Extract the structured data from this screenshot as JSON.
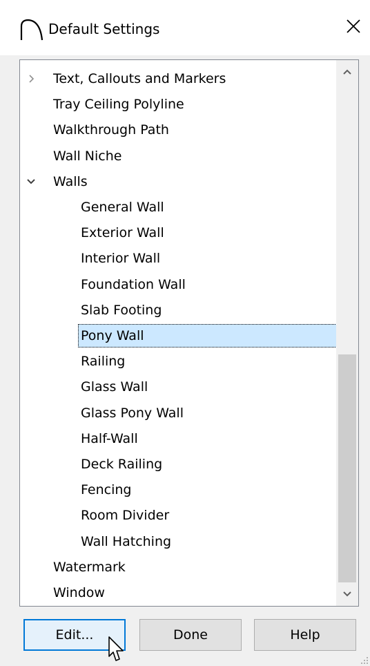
{
  "window": {
    "title": "Default Settings",
    "close_glyph": "✕"
  },
  "tree": {
    "items": [
      {
        "label": "Text, Callouts and Markers",
        "level": 0,
        "twisty": "collapsed"
      },
      {
        "label": "Tray Ceiling Polyline",
        "level": 0,
        "twisty": "none"
      },
      {
        "label": "Walkthrough Path",
        "level": 0,
        "twisty": "none"
      },
      {
        "label": "Wall Niche",
        "level": 0,
        "twisty": "none"
      },
      {
        "label": "Walls",
        "level": 0,
        "twisty": "expanded"
      },
      {
        "label": "General Wall",
        "level": 1,
        "twisty": "none"
      },
      {
        "label": "Exterior Wall",
        "level": 1,
        "twisty": "none"
      },
      {
        "label": "Interior Wall",
        "level": 1,
        "twisty": "none"
      },
      {
        "label": "Foundation Wall",
        "level": 1,
        "twisty": "none"
      },
      {
        "label": "Slab Footing",
        "level": 1,
        "twisty": "none"
      },
      {
        "label": "Pony Wall",
        "level": 1,
        "twisty": "none",
        "selected": true
      },
      {
        "label": "Railing",
        "level": 1,
        "twisty": "none"
      },
      {
        "label": "Glass Wall",
        "level": 1,
        "twisty": "none"
      },
      {
        "label": "Glass Pony Wall",
        "level": 1,
        "twisty": "none"
      },
      {
        "label": "Half-Wall",
        "level": 1,
        "twisty": "none"
      },
      {
        "label": "Deck Railing",
        "level": 1,
        "twisty": "none"
      },
      {
        "label": "Fencing",
        "level": 1,
        "twisty": "none"
      },
      {
        "label": "Room Divider",
        "level": 1,
        "twisty": "none"
      },
      {
        "label": "Wall Hatching",
        "level": 1,
        "twisty": "none"
      },
      {
        "label": "Watermark",
        "level": 0,
        "twisty": "none"
      },
      {
        "label": "Window",
        "level": 0,
        "twisty": "none"
      }
    ],
    "scroll": {
      "up_icon": "chevron-up-icon",
      "down_icon": "chevron-down-icon",
      "position": 1.0
    }
  },
  "buttons": {
    "edit": "Edit...",
    "done": "Done",
    "help": "Help"
  },
  "colors": {
    "selection": "#cce8ff",
    "default_button_border": "#0078d7"
  }
}
